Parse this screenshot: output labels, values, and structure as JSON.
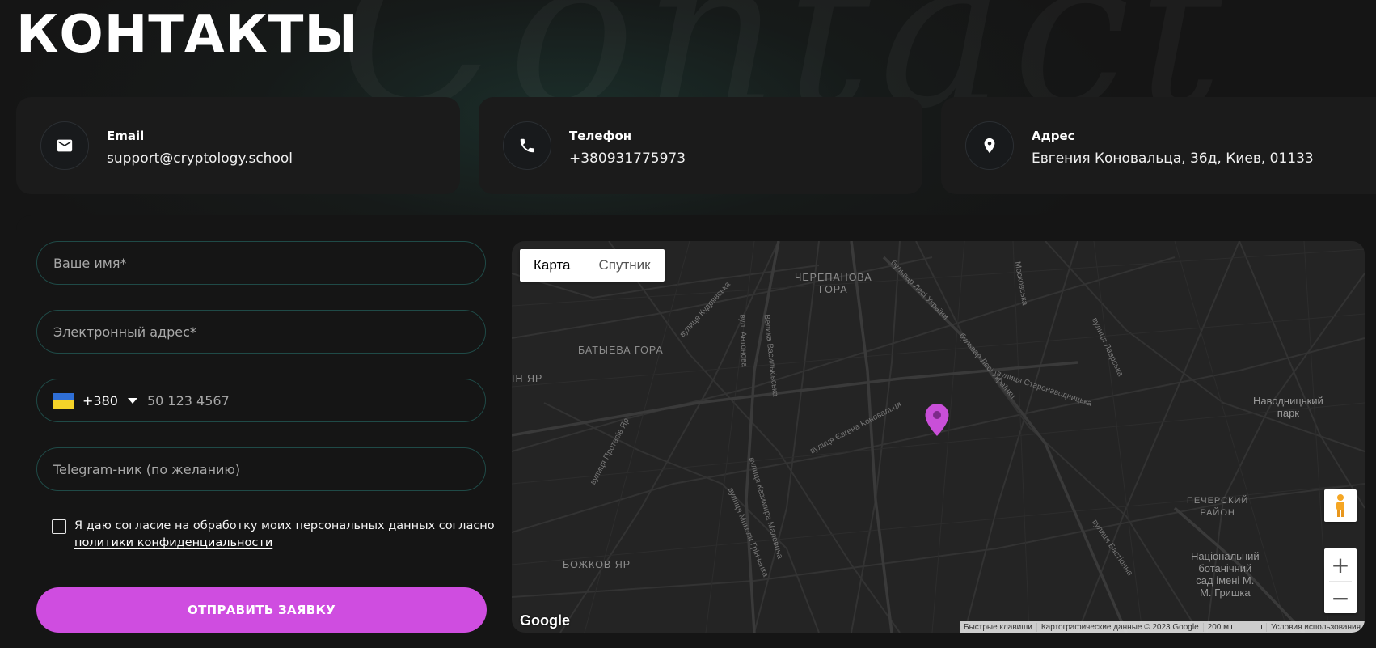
{
  "page": {
    "title": "КОНТАКТЫ",
    "decor": "Contact"
  },
  "contacts": [
    {
      "label": "Email",
      "value": "support@cryptology.school",
      "icon": "envelope-icon"
    },
    {
      "label": "Телефон",
      "value": "+380931775973",
      "icon": "phone-icon"
    },
    {
      "label": "Адрес",
      "value": "Евгения Коновальца, 36д, Киев, 01133",
      "icon": "location-pin-icon"
    }
  ],
  "form": {
    "name_placeholder": "Ваше имя*",
    "email_placeholder": "Электронный адрес*",
    "phone_dial_code": "+380",
    "phone_country_flag": "ua-flag",
    "phone_placeholder": "50 123 4567",
    "telegram_placeholder": "Telegram-ник (по желанию)",
    "consent_text": "Я даю согласие на обработку моих персональных данных согласно",
    "consent_link": "политики конфиденциальности",
    "submit_label": "ОТПРАВИТЬ ЗАЯВКУ"
  },
  "map": {
    "type_map": "Карта",
    "type_satellite": "Спутник",
    "labels": {
      "cherepanova": "ЧЕРЕПАНОВА\nГОРА",
      "batyeva": "БАТЫЕВА ГОРА",
      "yar": "ІН ЯР",
      "bozhkov": "БОЖКОВ ЯР",
      "pechersk": "ПЕЧЕРСКИЙ\nРАЙОН",
      "navodnytskyi": "Наводницький\nпарк",
      "botanic": "Національний\nботанічний\nсад імені М.\nМ. Гришка"
    },
    "streets": {
      "lesi1": "бульвар Лесі України",
      "lesi2": "бульвар Лесі Українки",
      "kudryavska": "вулиця Кудрявська",
      "vasylkivska": "Велика Васильківська",
      "antonova": "вул. Антонова",
      "konovaltsa": "вулиця Євгена Коновальця",
      "starovodnytska": "вулиця Старонаводницька",
      "protasiv": "вулиця Протасів Яр",
      "mykoly": "вулиця Миколи Грінченка",
      "kazymyra": "вулиця Казимира Малевича",
      "moskovska": "Московська",
      "lavrska": "вулиця Лаврська",
      "bastionna": "вулиця Бастіонна"
    },
    "pegman_icon": "pegman-icon",
    "zoom_in": "+",
    "zoom_out": "−",
    "logo": "Google",
    "shortcuts": "Быстрые клавиши",
    "map_data": "Картографические данные © 2023 Google",
    "scale": "200 м",
    "terms": "Условия использования",
    "marker_color": "#c94fd8"
  },
  "colors": {
    "accent": "#cf4de0",
    "field_border": "#1f4a47"
  }
}
